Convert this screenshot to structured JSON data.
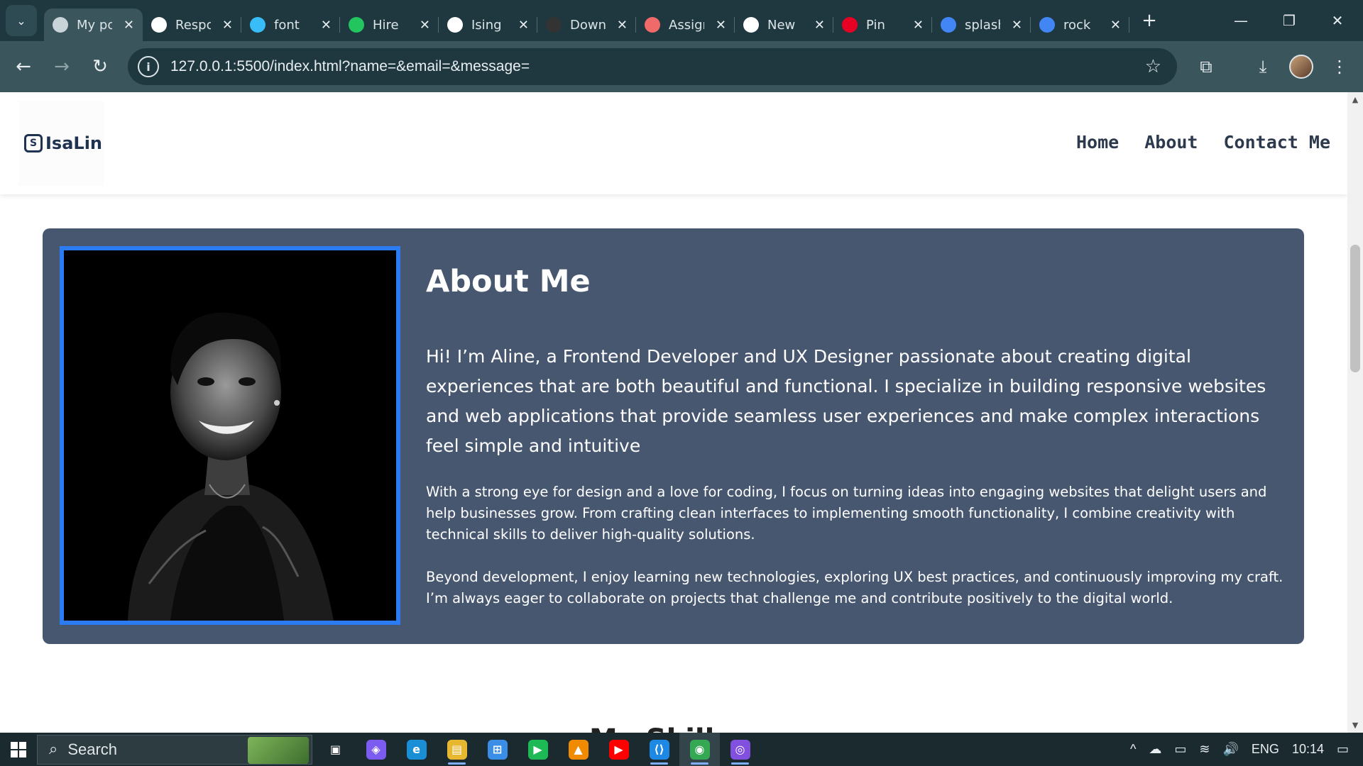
{
  "browser": {
    "tabs": [
      {
        "title": "My portfolio",
        "favicon": "globe-icon",
        "color": "#c9d4d8",
        "active": true
      },
      {
        "title": "Responsive",
        "favicon": "openai-icon",
        "color": "#ffffff",
        "active": false
      },
      {
        "title": "font",
        "favicon": "tailwind-icon",
        "color": "#38bdf8",
        "active": false
      },
      {
        "title": "Hire",
        "favicon": "hire-icon",
        "color": "#22c55e",
        "active": false
      },
      {
        "title": "Ising",
        "favicon": "github-icon",
        "color": "#ffffff",
        "active": false
      },
      {
        "title": "Download",
        "favicon": "xfs-icon",
        "color": "#333333",
        "active": false
      },
      {
        "title": "Assignment",
        "favicon": "asana-icon",
        "color": "#f06a6a",
        "active": false
      },
      {
        "title": "New",
        "favicon": "openai-icon",
        "color": "#ffffff",
        "active": false
      },
      {
        "title": "Pin",
        "favicon": "pinterest-icon",
        "color": "#e60023",
        "active": false
      },
      {
        "title": "splash",
        "favicon": "google-icon",
        "color": "#4285f4",
        "active": false
      },
      {
        "title": "rock",
        "favicon": "google-icon",
        "color": "#4285f4",
        "active": false
      }
    ],
    "url": "127.0.0.1:5500/index.html?name=&email=&message=",
    "glyphs": {
      "tab_search": "⌄",
      "close": "✕",
      "new_tab": "+",
      "minimize": "—",
      "restore": "❐",
      "window_close": "✕",
      "back": "←",
      "forward": "→",
      "reload": "↻",
      "info": "i",
      "star": "☆",
      "extensions": "⧉",
      "download": "⤓",
      "menu": "⋮"
    }
  },
  "site": {
    "logo": {
      "mark": "S",
      "text": "IsaLin"
    },
    "nav": [
      "Home",
      "About",
      "Contact Me"
    ],
    "about": {
      "title": "About Me",
      "lead": "Hi! I’m Aline, a Frontend Developer and UX Designer passionate about creating digital experiences that are both beautiful and functional. I specialize in building responsive websites and web applications that provide seamless user experiences and make complex interactions feel simple and intuitive",
      "p2": "With a strong eye for design and a love for coding, I focus on turning ideas into engaging websites that delight users and help businesses grow. From crafting clean interfaces to implementing smooth functionality, I combine creativity with technical skills to deliver high-quality solutions.",
      "p3": "Beyond development, I enjoy learning new technologies, exploring UX best practices, and continuously improving my craft. I’m always eager to collaborate on projects that challenge me and contribute positively to the digital world."
    },
    "next_section_heading": "My Skills",
    "colors": {
      "card": "#485770",
      "photo_border": "#2b7bf2",
      "nav_text": "#2d3a4d"
    }
  },
  "taskbar": {
    "search_label": "Search",
    "search_glyph": "⌕",
    "apps": [
      {
        "name": "task-view-icon",
        "glyph": "▣",
        "color": "transparent"
      },
      {
        "name": "copilot-icon",
        "glyph": "◈",
        "color": "#7c5cf0"
      },
      {
        "name": "edge-icon",
        "glyph": "e",
        "color": "#1a8fd6"
      },
      {
        "name": "file-explorer-icon",
        "glyph": "▤",
        "color": "#e8b730"
      },
      {
        "name": "store-icon",
        "glyph": "⊞",
        "color": "#3a8ee6"
      },
      {
        "name": "play-store-icon",
        "glyph": "▶",
        "color": "#1db954"
      },
      {
        "name": "vlc-icon",
        "glyph": "▲",
        "color": "#f08a00"
      },
      {
        "name": "youtube-icon",
        "glyph": "▶",
        "color": "#ff0000"
      },
      {
        "name": "vscode-icon",
        "glyph": "⟨⟩",
        "color": "#1e88e5"
      },
      {
        "name": "chrome-icon",
        "glyph": "◉",
        "color": "#34a853"
      },
      {
        "name": "github-desktop-icon",
        "glyph": "◎",
        "color": "#8250df"
      }
    ],
    "tray": {
      "language": "ENG",
      "time": "10:14",
      "chevron": "^",
      "cloud": "☁",
      "battery": "▭",
      "wifi": "≋",
      "volume": "🔊",
      "notifications": "▭"
    }
  }
}
